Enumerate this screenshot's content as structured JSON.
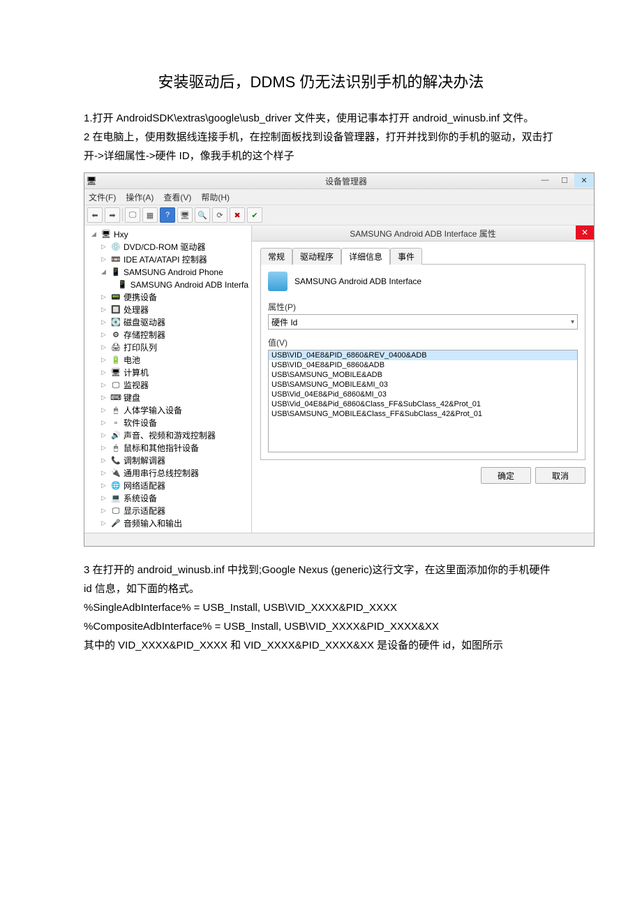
{
  "title": "安装驱动后，DDMS 仍无法识别手机的解决办法",
  "para1": "1.打开 AndroidSDK\\extras\\google\\usb_driver 文件夹，使用记事本打开 android_winusb.inf 文件。",
  "para2": "2 在电脑上，使用数据线连接手机，在控制面板找到设备管理器，打开并找到你的手机的驱动，双击打开->详细属性->硬件 ID，像我手机的这个样子",
  "para3": "3 在打开的 android_winusb.inf 中找到;Google Nexus (generic)这行文字，在这里面添加你的手机硬件 id 信息，如下面的格式。",
  "code1": "%SingleAdbInterface% = USB_Install, USB\\VID_XXXX&PID_XXXX",
  "code2": "%CompositeAdbInterface% = USB_Install, USB\\VID_XXXX&PID_XXXX&XX",
  "para4": "其中的 VID_XXXX&PID_XXXX 和 VID_XXXX&PID_XXXX&XX 是设备的硬件 id，如图所示",
  "devmgr": {
    "title": "设备管理器",
    "menu": {
      "file": "文件(F)",
      "action": "操作(A)",
      "view": "查看(V)",
      "help": "帮助(H)"
    },
    "tree": {
      "root": "Hxy",
      "items": [
        "DVD/CD-ROM 驱动器",
        "IDE ATA/ATAPI 控制器",
        "SAMSUNG Android Phone",
        "SAMSUNG Android ADB Interfa",
        "便携设备",
        "处理器",
        "磁盘驱动器",
        "存储控制器",
        "打印队列",
        "电池",
        "计算机",
        "监视器",
        "键盘",
        "人体学输入设备",
        "软件设备",
        "声音、视频和游戏控制器",
        "鼠标和其他指针设备",
        "调制解调器",
        "通用串行总线控制器",
        "网络适配器",
        "系统设备",
        "显示适配器",
        "音频输入和输出"
      ]
    }
  },
  "prop": {
    "title": "SAMSUNG Android ADB Interface 属性",
    "device_name": "SAMSUNG Android ADB Interface",
    "tabs": {
      "general": "常规",
      "driver": "驱动程序",
      "details": "详细信息",
      "events": "事件"
    },
    "prop_label": "属性(P)",
    "prop_select": "硬件 Id",
    "value_label": "值(V)",
    "values": [
      "USB\\VID_04E8&PID_6860&REV_0400&ADB",
      "USB\\VID_04E8&PID_6860&ADB",
      "USB\\SAMSUNG_MOBILE&ADB",
      "USB\\SAMSUNG_MOBILE&MI_03",
      "USB\\Vid_04E8&Pid_6860&MI_03",
      "USB\\Vid_04E8&Pid_6860&Class_FF&SubClass_42&Prot_01",
      "USB\\SAMSUNG_MOBILE&Class_FF&SubClass_42&Prot_01"
    ],
    "ok": "确定",
    "cancel": "取消"
  }
}
